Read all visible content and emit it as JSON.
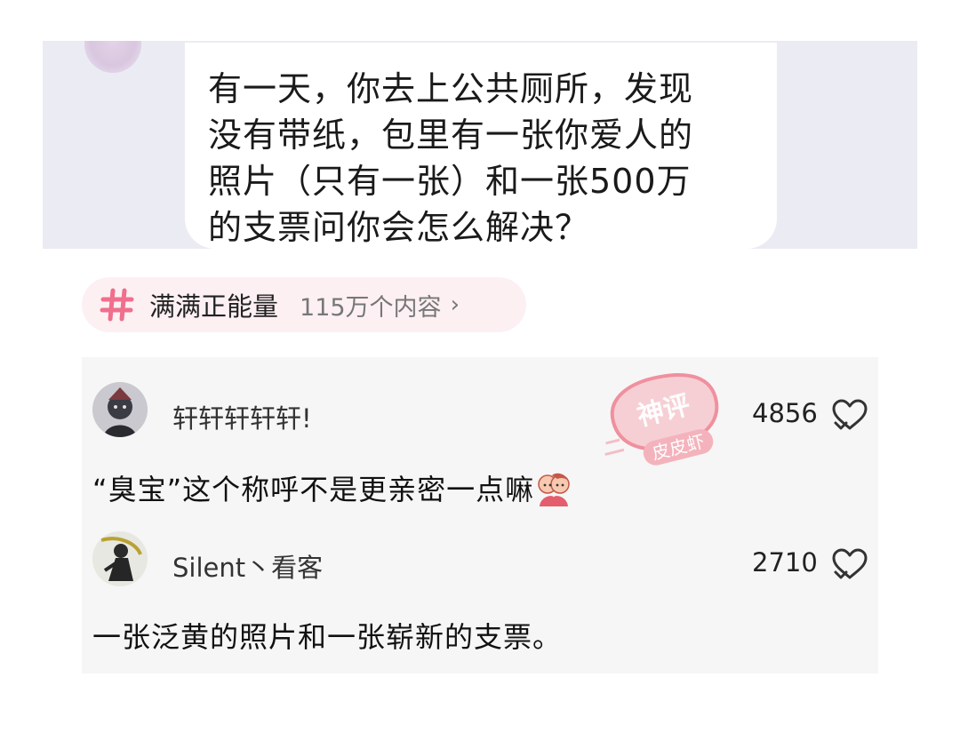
{
  "post": {
    "question_lines": [
      "有一天，你去上公共厕所，发现",
      "没有带纸，包里有一张你爱人的",
      "照片（只有一张）和一张500万",
      "的支票问你会怎么解决？"
    ]
  },
  "topic": {
    "icon": "hashtag-icon",
    "name": "满满正能量",
    "count": "115万个内容"
  },
  "comments": [
    {
      "username": "轩轩轩轩轩!",
      "likes": "4856",
      "text": "“臭宝”这个称呼不是更亲密一点嘛",
      "emoji": "couple-hug-emoji"
    },
    {
      "username": "Silent丶看客",
      "likes": "2710",
      "text": "一张泛黄的照片和一张崭新的支票。"
    }
  ],
  "watermark": {
    "top_text": "神评",
    "bottom_text": "皮皮虾"
  },
  "colors": {
    "accent_pink": "#ef6f8c",
    "chip_bg": "#fdf0f3",
    "card_bg": "#f6f6f6",
    "post_bg": "#ebebf4"
  }
}
